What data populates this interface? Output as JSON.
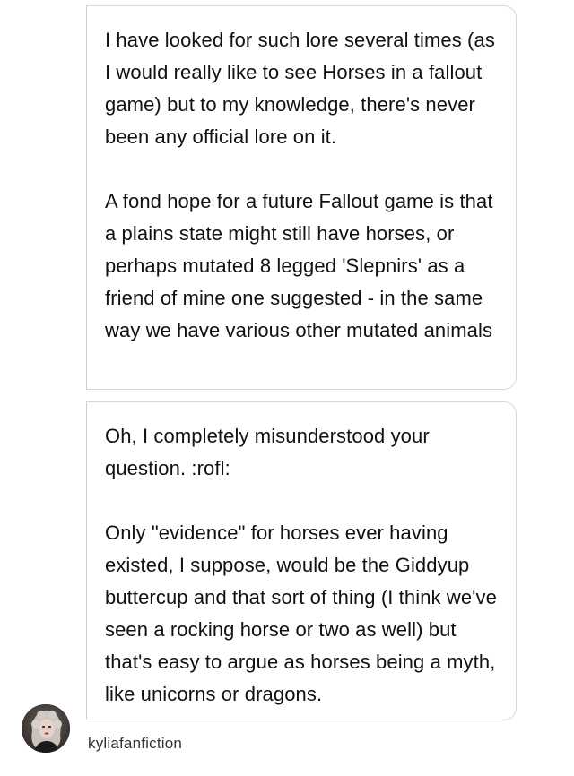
{
  "conversation": {
    "messages": [
      {
        "paragraphs": [
          "I have looked for such lore several times (as I would really like to see Horses in a fallout game) but to my knowledge, there's never been any official lore on it.",
          "A fond hope for a future Fallout game is that a plains state might still have horses, or perhaps mutated 8 legged 'Slepnirs' as a friend of mine one suggested - in the same way we have various other mutated animals"
        ]
      },
      {
        "paragraphs": [
          "Oh, I completely misunderstood your question. :rofl:",
          "Only \"evidence\" for horses ever having existed, I suppose, would be the Giddyup buttercup and that sort of thing (I think we've seen a rocking horse or two as well) but that's easy to argue as horses being a myth, like unicorns or dragons."
        ]
      }
    ],
    "author": {
      "username": "kyliafanfiction",
      "avatar_icon": "user-avatar"
    }
  },
  "colors": {
    "bubble_border": "#d7d7d7",
    "text": "#111111",
    "username": "#333333"
  }
}
